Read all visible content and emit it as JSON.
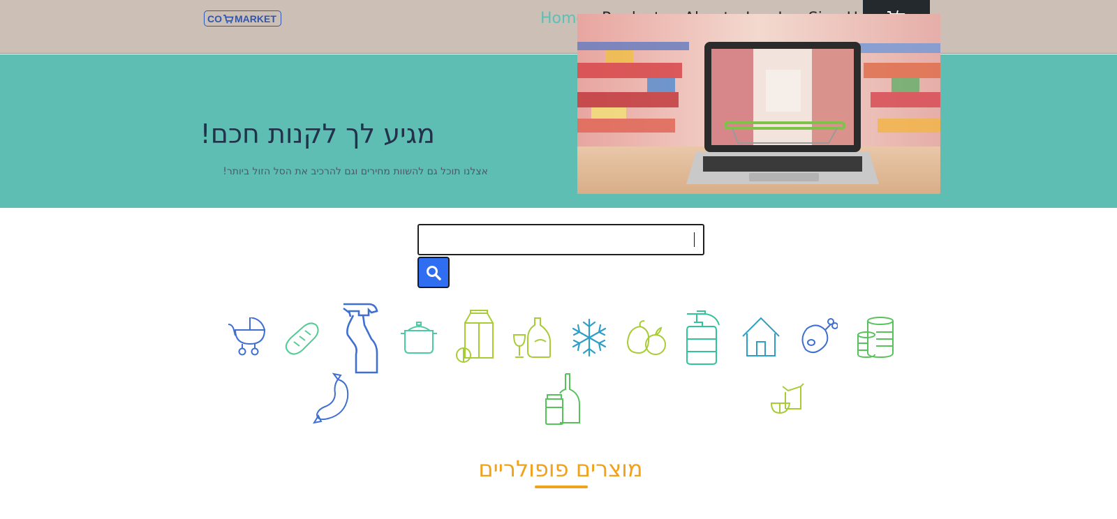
{
  "logo": {
    "text_left": "CO",
    "text_right": "MARKET"
  },
  "nav": {
    "items": [
      {
        "label": "Home",
        "active": true
      },
      {
        "label": "Products",
        "active": false
      },
      {
        "label": "About",
        "active": false
      },
      {
        "label": "Log In",
        "active": false
      },
      {
        "label": "Sign Up",
        "active": false
      }
    ],
    "cart_icon": "cart-icon"
  },
  "hero": {
    "title": "מגיע לך לקנות חכם!",
    "subtitle": "אצלנו תוכל גם להשוות מחירים וגם להרכיב את הסל הזול ביותר!"
  },
  "search": {
    "value": "",
    "placeholder": "",
    "button_icon": "search-icon"
  },
  "categories": [
    {
      "icon": "baby-stroller-icon"
    },
    {
      "icon": "bread-icon"
    },
    {
      "icon": "spray-bottle-icon"
    },
    {
      "icon": "cooking-pot-icon"
    },
    {
      "icon": "milk-carton-icon"
    },
    {
      "icon": "wine-icon"
    },
    {
      "icon": "snowflake-icon"
    },
    {
      "icon": "fruit-icon"
    },
    {
      "icon": "soap-dispenser-icon"
    },
    {
      "icon": "house-icon"
    },
    {
      "icon": "chicken-leg-icon"
    },
    {
      "icon": "canned-goods-icon"
    },
    {
      "icon": "sausage-icon"
    },
    {
      "icon": "bottle-and-jar-icon"
    },
    {
      "icon": "snacks-icon"
    }
  ],
  "popular": {
    "title": "מוצרים פופולריים"
  },
  "colors": {
    "nav_bg": "#cbbfb6",
    "hero_bg": "#5ebeb4",
    "active_link": "#5fbfb5",
    "accent_orange": "#f0a21b",
    "search_btn": "#2f6ef0",
    "cart_btn": "#24292e"
  }
}
